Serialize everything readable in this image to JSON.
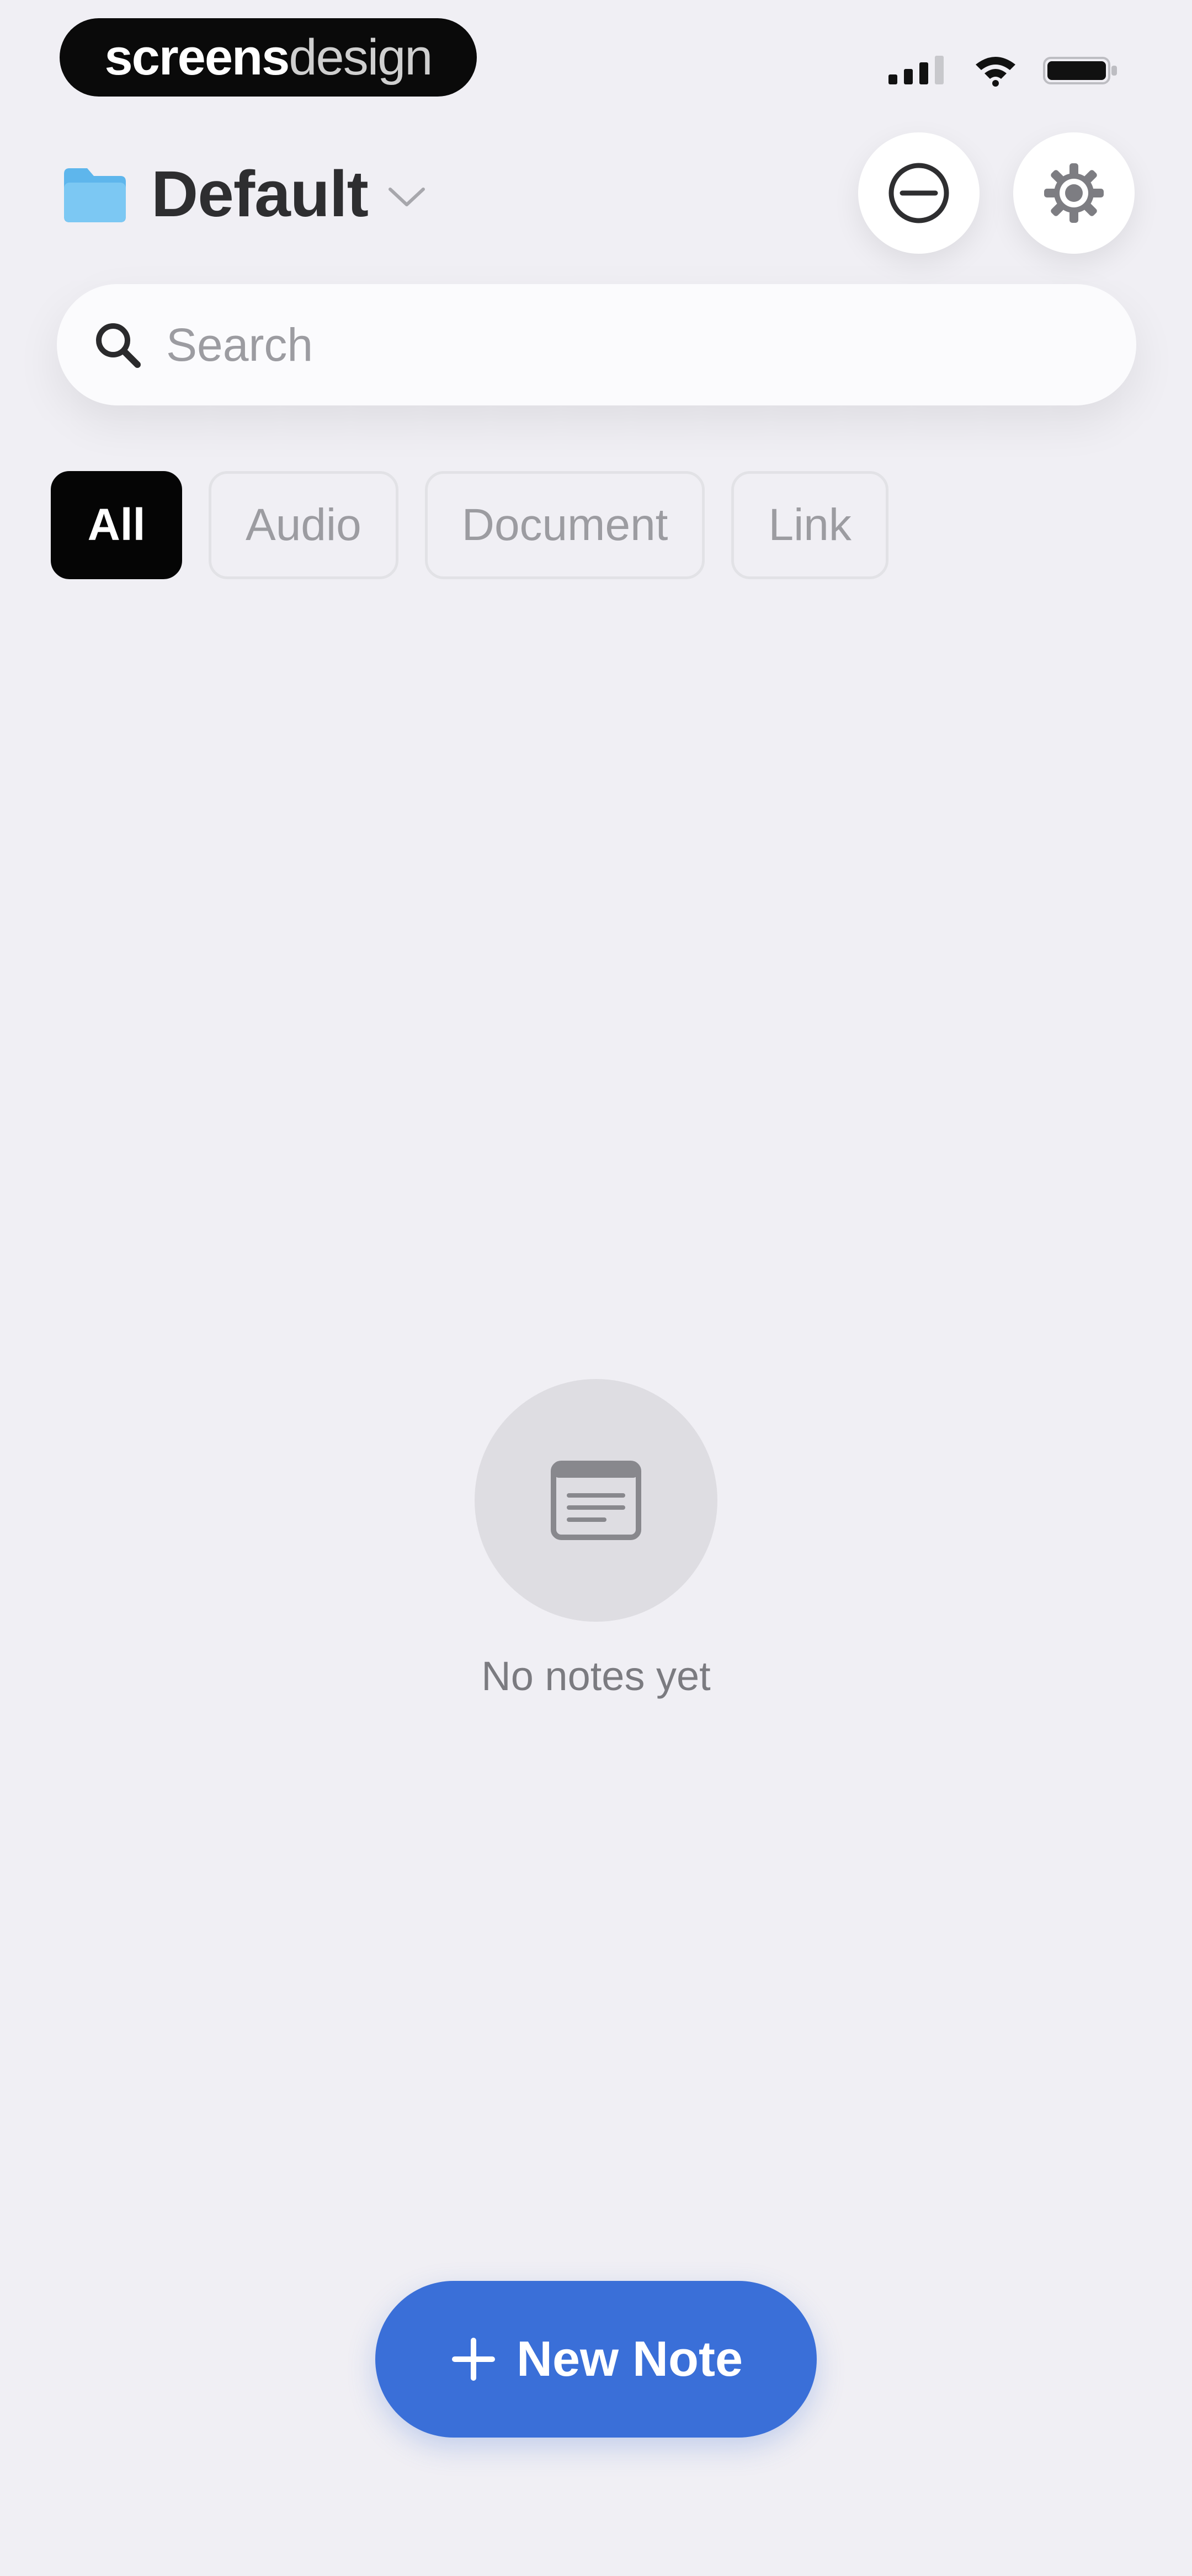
{
  "watermark": {
    "part1": "screens",
    "part2": "design"
  },
  "header": {
    "folder_name": "Default"
  },
  "search": {
    "placeholder": "Search",
    "value": ""
  },
  "filters": [
    {
      "label": "All",
      "selected": true
    },
    {
      "label": "Audio",
      "selected": false
    },
    {
      "label": "Document",
      "selected": false
    },
    {
      "label": "Link",
      "selected": false
    }
  ],
  "empty_state": {
    "message": "No notes yet"
  },
  "new_note_button": {
    "label": "New Note"
  },
  "icons": {
    "folder": "folder-icon",
    "chevron": "chevron-down-icon",
    "minus_circle": "minus-circle-icon",
    "gear": "gear-icon",
    "search": "search-icon",
    "note": "note-icon",
    "plus": "plus-icon"
  },
  "colors": {
    "background": "#f0eff4",
    "accent": "#3a6fd8",
    "folder": "#5eb6ec",
    "active_chip": "#050505"
  }
}
